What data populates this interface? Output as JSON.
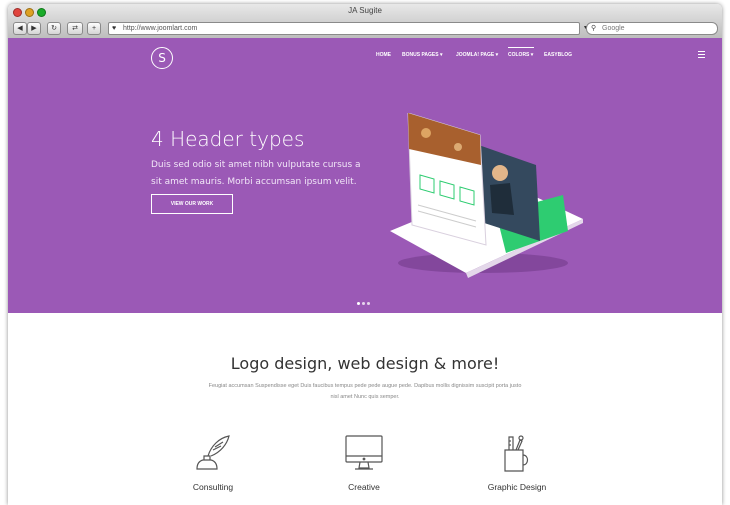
{
  "window": {
    "title": "JA Sugite",
    "address": "http://www.joomlart.com",
    "search_placeholder": "Google"
  },
  "nav": {
    "logo_letter": "S",
    "items": [
      "HOME",
      "BONUS PAGES ▾",
      "JOOMLA! PAGE ▾",
      "COLORS ▾",
      "EASYBLOG"
    ],
    "active_index": 3
  },
  "hero": {
    "title": "4 Header types",
    "description": "Duis sed odio sit amet nibh vulputate cursus a sit amet mauris. Morbi accumsan ipsum velit.",
    "button_label": "VIEW OUR WORK",
    "slide_count": 3,
    "active_slide": 0
  },
  "section": {
    "title": "Logo design, web design & more!",
    "text": "Feugiat accumsan Suspendisse eget Duis faucibus tempus pede pede augue pede. Dapibus mollis dignissim suscipit porta justo nisl amet Nunc quis semper.",
    "features": [
      {
        "label": "Consulting",
        "icon": "quill-inkwell-icon"
      },
      {
        "label": "Creative",
        "icon": "monitor-icon"
      },
      {
        "label": "Graphic Design",
        "icon": "tools-cup-icon"
      }
    ]
  },
  "colors": {
    "hero_bg": "#9b59b6",
    "text": "#333333"
  }
}
